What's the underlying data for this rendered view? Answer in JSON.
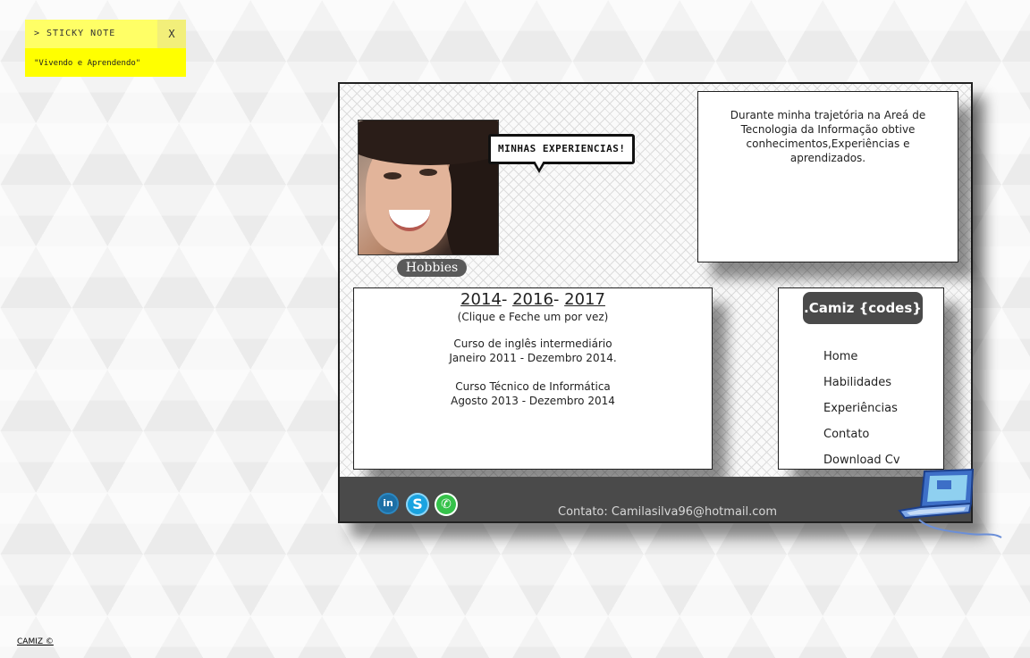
{
  "sticky_note": {
    "title": "> STICKY NOTE",
    "close_label": "X",
    "text": "\"Vivendo e Aprendendo\""
  },
  "profile": {
    "speech_bubble": "MINHAS EXPERIENCIAS!",
    "hobbies_label": "Hobbies"
  },
  "about": {
    "text": "Durante minha trajetória na Areá de Tecnologia da Informação obtive conhecimentos,Experiências e aprendizados."
  },
  "timeline": {
    "years": [
      "2014",
      "2016",
      "2017"
    ],
    "separator": "-",
    "hint": "(Clique e Feche um por vez)",
    "courses": [
      {
        "name": "Curso de inglês intermediário",
        "period": "Janeiro 2011 - Dezembro 2014."
      },
      {
        "name": "Curso Técnico de Informática",
        "period": "Agosto 2013 - Dezembro 2014"
      }
    ]
  },
  "menu": {
    "brand": ".Camiz {codes}",
    "items": [
      "Home",
      "Habilidades",
      "Experiências",
      "Contato",
      "Download Cv"
    ]
  },
  "footer": {
    "social": [
      {
        "name": "linkedin",
        "glyph": "in"
      },
      {
        "name": "skype",
        "glyph": "S"
      },
      {
        "name": "whatsapp",
        "glyph": "✆"
      }
    ],
    "contact": "Contato: Camilasilva96@hotmail.com"
  },
  "copyright": "CAMIZ ©",
  "colors": {
    "sticky_head": "#ffff66",
    "sticky_body": "#ffff00",
    "dark_panel": "#4a4a4a",
    "linkedin": "#1d6fa5",
    "skype": "#1aa3e0",
    "whatsapp": "#35c24a"
  }
}
